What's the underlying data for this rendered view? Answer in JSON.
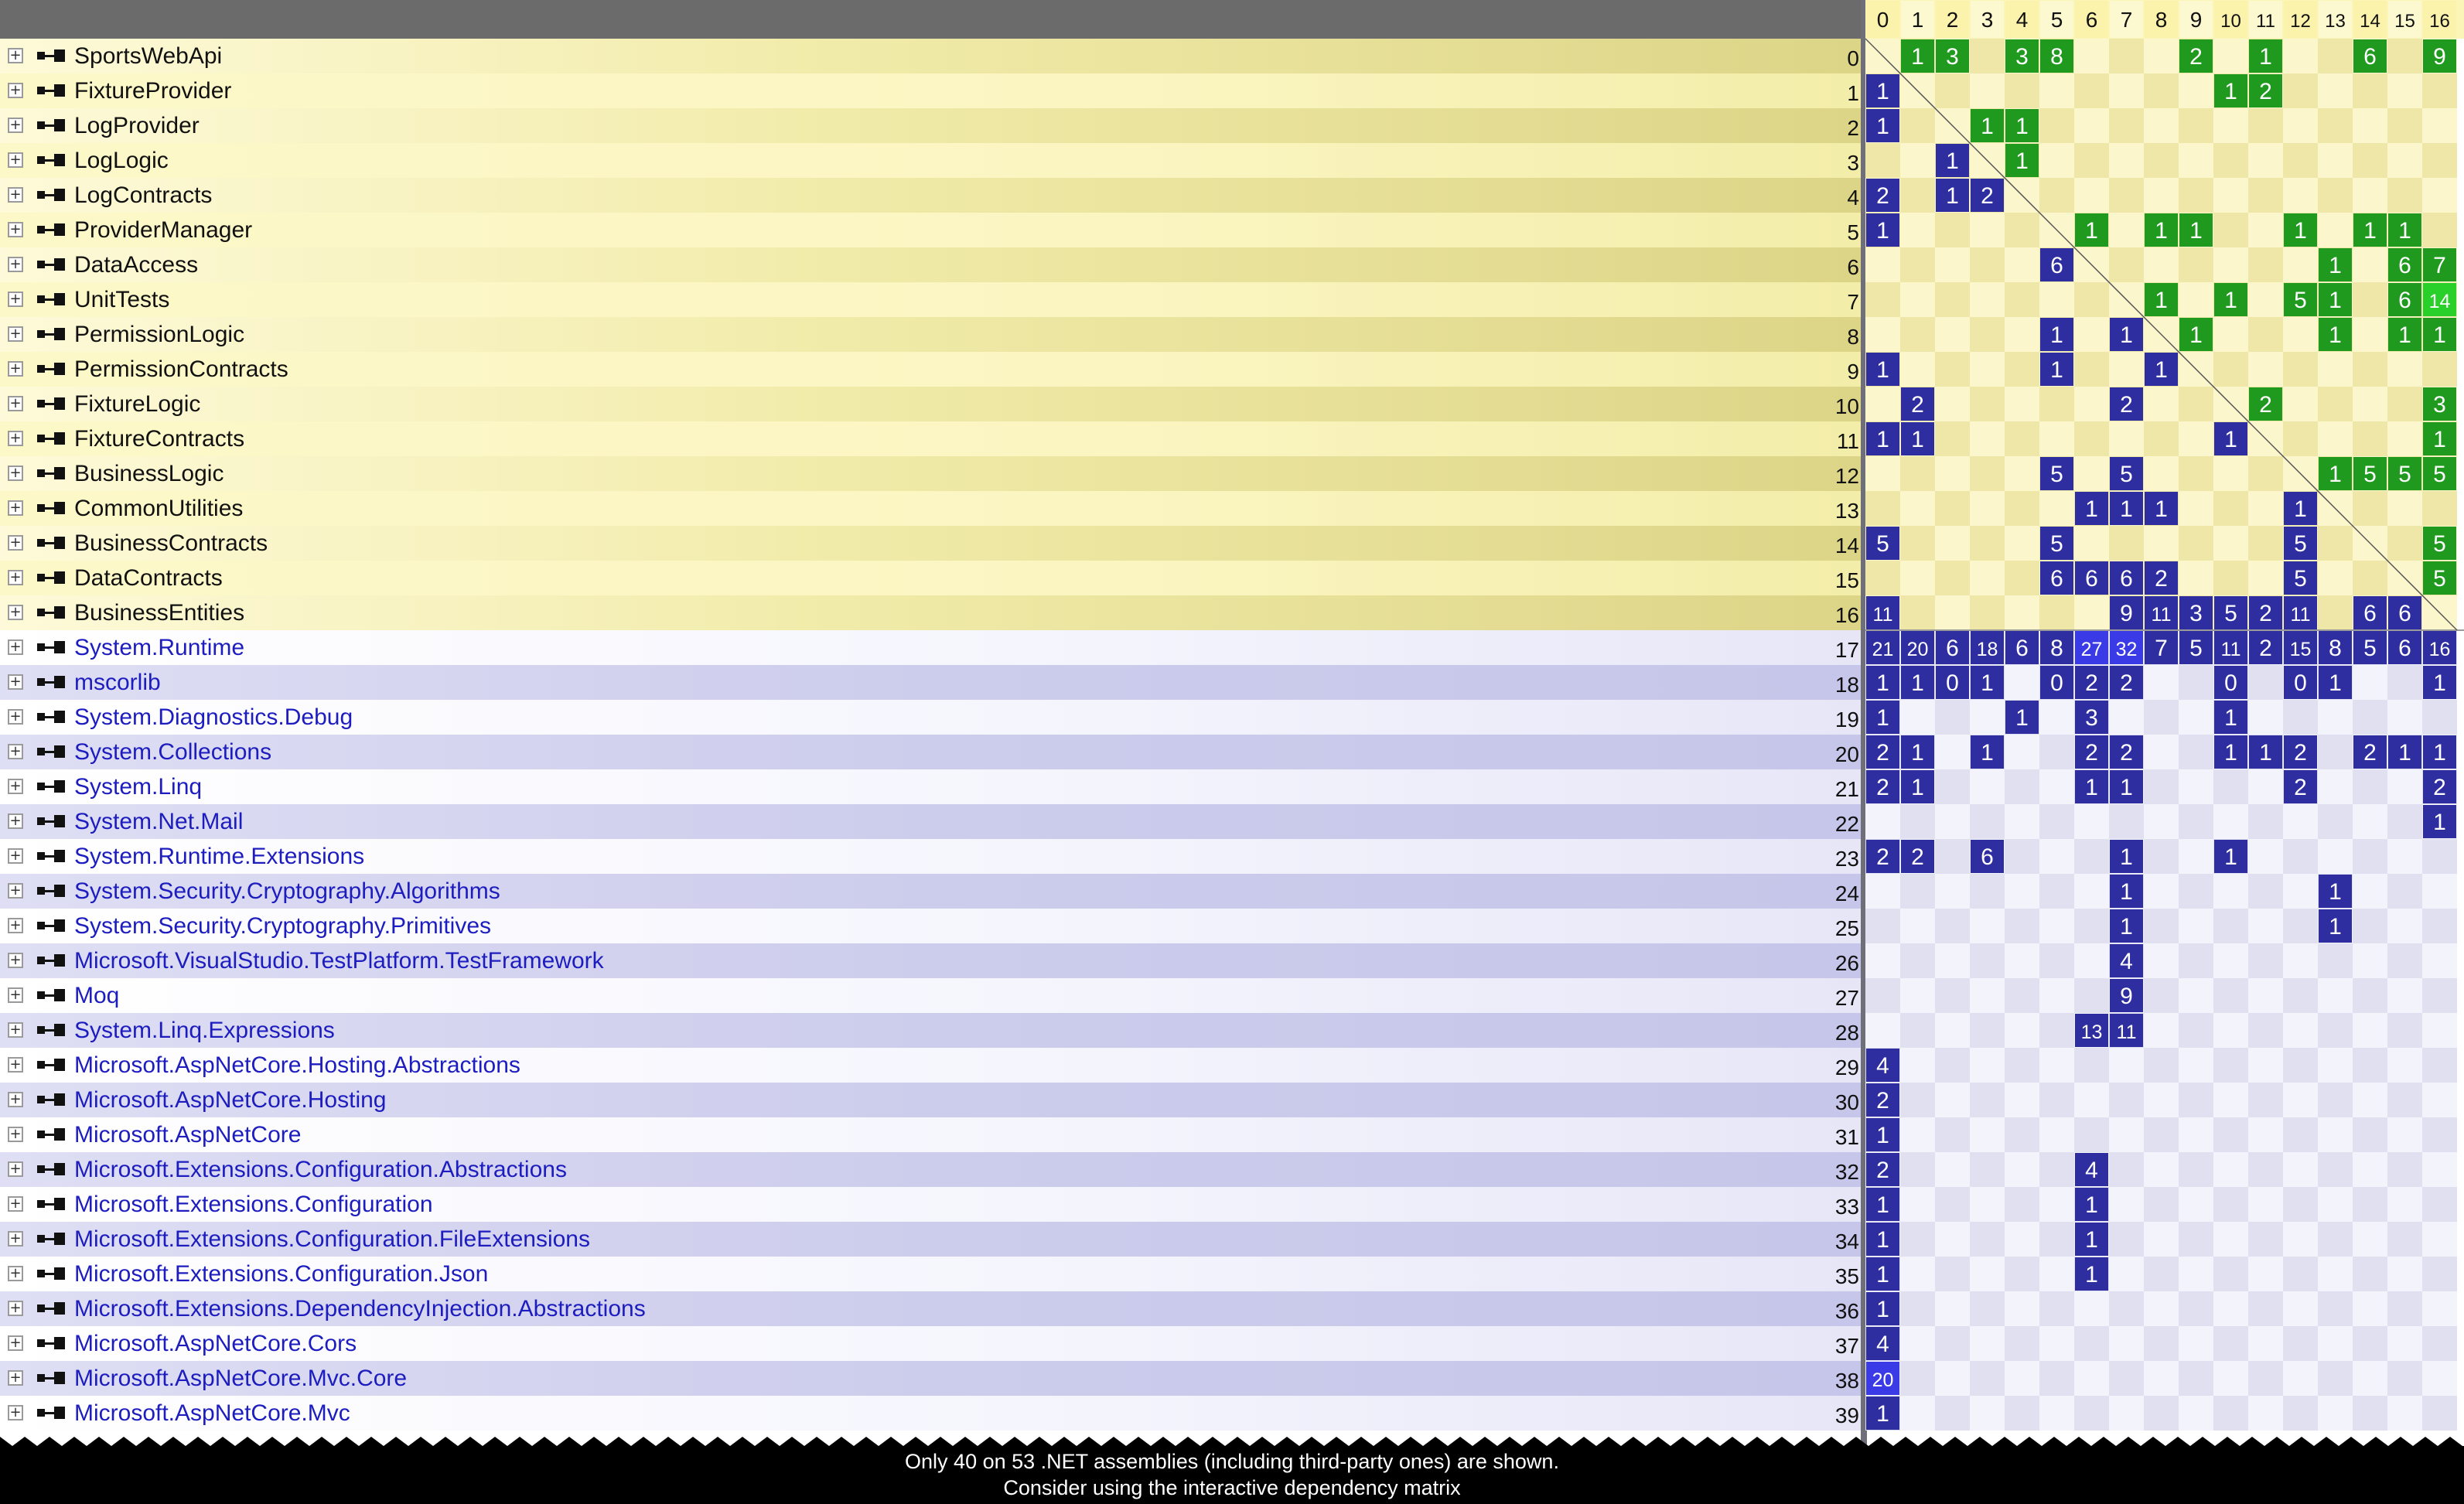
{
  "colors": {
    "app_row_even": "#dcd486",
    "app_row_odd": "#fdf8c8",
    "sys_row_even": "#c6c6ea",
    "sys_row_odd": "#f4f4fd",
    "app_text": "#111111",
    "sys_text": "#1d1dbf",
    "cell_used_by": "#2e2ea0",
    "cell_uses": "#1f9a1f",
    "cell_bright": "#3a3ae6",
    "cell_bright_green": "#2ad02a",
    "header_bg": "#fcf5b8",
    "matrix_app_a": "#fbf6cc",
    "matrix_app_b": "#efe7a8",
    "matrix_sys_a": "#f3f3fb",
    "matrix_sys_b": "#e0e0f1"
  },
  "row_icons": {
    "expander": "plus-icon",
    "assembly": "assembly-icon"
  },
  "columns": [
    "0",
    "1",
    "2",
    "3",
    "4",
    "5",
    "6",
    "7",
    "8",
    "9",
    "10",
    "11",
    "12",
    "13",
    "14",
    "15",
    "16"
  ],
  "rows": [
    {
      "name": "SportsWebApi",
      "index": "0",
      "kind": "app"
    },
    {
      "name": "FixtureProvider",
      "index": "1",
      "kind": "app"
    },
    {
      "name": "LogProvider",
      "index": "2",
      "kind": "app"
    },
    {
      "name": "LogLogic",
      "index": "3",
      "kind": "app"
    },
    {
      "name": "LogContracts",
      "index": "4",
      "kind": "app"
    },
    {
      "name": "ProviderManager",
      "index": "5",
      "kind": "app"
    },
    {
      "name": "DataAccess",
      "index": "6",
      "kind": "app"
    },
    {
      "name": "UnitTests",
      "index": "7",
      "kind": "app"
    },
    {
      "name": "PermissionLogic",
      "index": "8",
      "kind": "app"
    },
    {
      "name": "PermissionContracts",
      "index": "9",
      "kind": "app"
    },
    {
      "name": "FixtureLogic",
      "index": "10",
      "kind": "app"
    },
    {
      "name": "FixtureContracts",
      "index": "11",
      "kind": "app"
    },
    {
      "name": "BusinessLogic",
      "index": "12",
      "kind": "app"
    },
    {
      "name": "CommonUtilities",
      "index": "13",
      "kind": "app"
    },
    {
      "name": "BusinessContracts",
      "index": "14",
      "kind": "app"
    },
    {
      "name": "DataContracts",
      "index": "15",
      "kind": "app"
    },
    {
      "name": "BusinessEntities",
      "index": "16",
      "kind": "app"
    },
    {
      "name": "System.Runtime",
      "index": "17",
      "kind": "sys"
    },
    {
      "name": "mscorlib",
      "index": "18",
      "kind": "sys"
    },
    {
      "name": "System.Diagnostics.Debug",
      "index": "19",
      "kind": "sys"
    },
    {
      "name": "System.Collections",
      "index": "20",
      "kind": "sys"
    },
    {
      "name": "System.Linq",
      "index": "21",
      "kind": "sys"
    },
    {
      "name": "System.Net.Mail",
      "index": "22",
      "kind": "sys"
    },
    {
      "name": "System.Runtime.Extensions",
      "index": "23",
      "kind": "sys"
    },
    {
      "name": "System.Security.Cryptography.Algorithms",
      "index": "24",
      "kind": "sys"
    },
    {
      "name": "System.Security.Cryptography.Primitives",
      "index": "25",
      "kind": "sys"
    },
    {
      "name": "Microsoft.VisualStudio.TestPlatform.TestFramework",
      "index": "26",
      "kind": "sys"
    },
    {
      "name": "Moq",
      "index": "27",
      "kind": "sys"
    },
    {
      "name": "System.Linq.Expressions",
      "index": "28",
      "kind": "sys"
    },
    {
      "name": "Microsoft.AspNetCore.Hosting.Abstractions",
      "index": "29",
      "kind": "sys"
    },
    {
      "name": "Microsoft.AspNetCore.Hosting",
      "index": "30",
      "kind": "sys"
    },
    {
      "name": "Microsoft.AspNetCore",
      "index": "31",
      "kind": "sys"
    },
    {
      "name": "Microsoft.Extensions.Configuration.Abstractions",
      "index": "32",
      "kind": "sys"
    },
    {
      "name": "Microsoft.Extensions.Configuration",
      "index": "33",
      "kind": "sys"
    },
    {
      "name": "Microsoft.Extensions.Configuration.FileExtensions",
      "index": "34",
      "kind": "sys"
    },
    {
      "name": "Microsoft.Extensions.Configuration.Json",
      "index": "35",
      "kind": "sys"
    },
    {
      "name": "Microsoft.Extensions.DependencyInjection.Abstractions",
      "index": "36",
      "kind": "sys"
    },
    {
      "name": "Microsoft.AspNetCore.Cors",
      "index": "37",
      "kind": "sys"
    },
    {
      "name": "Microsoft.AspNetCore.Mvc.Core",
      "index": "38",
      "kind": "sys"
    },
    {
      "name": "Microsoft.AspNetCore.Mvc",
      "index": "39",
      "kind": "sys"
    }
  ],
  "cells": [
    [
      0,
      1,
      "1",
      "g"
    ],
    [
      0,
      2,
      "3",
      "g"
    ],
    [
      0,
      4,
      "3",
      "g"
    ],
    [
      0,
      5,
      "8",
      "g"
    ],
    [
      0,
      9,
      "2",
      "g"
    ],
    [
      0,
      11,
      "1",
      "g"
    ],
    [
      0,
      14,
      "6",
      "g"
    ],
    [
      0,
      16,
      "9",
      "g"
    ],
    [
      1,
      0,
      "1",
      "b"
    ],
    [
      1,
      10,
      "1",
      "g"
    ],
    [
      1,
      11,
      "2",
      "g"
    ],
    [
      2,
      0,
      "1",
      "b"
    ],
    [
      2,
      3,
      "1",
      "g"
    ],
    [
      2,
      4,
      "1",
      "g"
    ],
    [
      3,
      2,
      "1",
      "b"
    ],
    [
      3,
      4,
      "1",
      "g"
    ],
    [
      4,
      0,
      "2",
      "b"
    ],
    [
      4,
      2,
      "1",
      "b"
    ],
    [
      4,
      3,
      "2",
      "b"
    ],
    [
      5,
      0,
      "1",
      "b"
    ],
    [
      5,
      6,
      "1",
      "g"
    ],
    [
      5,
      8,
      "1",
      "g"
    ],
    [
      5,
      9,
      "1",
      "g"
    ],
    [
      5,
      12,
      "1",
      "g"
    ],
    [
      5,
      14,
      "1",
      "g"
    ],
    [
      5,
      15,
      "1",
      "g"
    ],
    [
      6,
      5,
      "6",
      "b"
    ],
    [
      6,
      13,
      "1",
      "g"
    ],
    [
      6,
      15,
      "6",
      "g"
    ],
    [
      6,
      16,
      "7",
      "g"
    ],
    [
      7,
      8,
      "1",
      "g"
    ],
    [
      7,
      10,
      "1",
      "g"
    ],
    [
      7,
      12,
      "5",
      "g"
    ],
    [
      7,
      13,
      "1",
      "g"
    ],
    [
      7,
      15,
      "6",
      "g"
    ],
    [
      7,
      16,
      "14",
      "G"
    ],
    [
      8,
      5,
      "1",
      "b"
    ],
    [
      8,
      7,
      "1",
      "b"
    ],
    [
      8,
      9,
      "1",
      "g"
    ],
    [
      8,
      13,
      "1",
      "g"
    ],
    [
      8,
      15,
      "1",
      "g"
    ],
    [
      8,
      16,
      "1",
      "g"
    ],
    [
      9,
      0,
      "1",
      "b"
    ],
    [
      9,
      5,
      "1",
      "b"
    ],
    [
      9,
      8,
      "1",
      "b"
    ],
    [
      10,
      1,
      "2",
      "b"
    ],
    [
      10,
      7,
      "2",
      "b"
    ],
    [
      10,
      11,
      "2",
      "g"
    ],
    [
      10,
      16,
      "3",
      "g"
    ],
    [
      11,
      0,
      "1",
      "b"
    ],
    [
      11,
      1,
      "1",
      "b"
    ],
    [
      11,
      10,
      "1",
      "b"
    ],
    [
      11,
      16,
      "1",
      "g"
    ],
    [
      12,
      5,
      "5",
      "b"
    ],
    [
      12,
      7,
      "5",
      "b"
    ],
    [
      12,
      13,
      "1",
      "g"
    ],
    [
      12,
      14,
      "5",
      "g"
    ],
    [
      12,
      15,
      "5",
      "g"
    ],
    [
      12,
      16,
      "5",
      "g"
    ],
    [
      13,
      6,
      "1",
      "b"
    ],
    [
      13,
      7,
      "1",
      "b"
    ],
    [
      13,
      8,
      "1",
      "b"
    ],
    [
      13,
      12,
      "1",
      "b"
    ],
    [
      14,
      0,
      "5",
      "b"
    ],
    [
      14,
      5,
      "5",
      "b"
    ],
    [
      14,
      12,
      "5",
      "b"
    ],
    [
      14,
      16,
      "5",
      "g"
    ],
    [
      15,
      5,
      "6",
      "b"
    ],
    [
      15,
      6,
      "6",
      "b"
    ],
    [
      15,
      7,
      "6",
      "b"
    ],
    [
      15,
      8,
      "2",
      "b"
    ],
    [
      15,
      12,
      "5",
      "b"
    ],
    [
      15,
      16,
      "5",
      "g"
    ],
    [
      16,
      0,
      "11",
      "b"
    ],
    [
      16,
      7,
      "9",
      "b"
    ],
    [
      16,
      8,
      "11",
      "b"
    ],
    [
      16,
      9,
      "3",
      "b"
    ],
    [
      16,
      10,
      "5",
      "b"
    ],
    [
      16,
      11,
      "2",
      "b"
    ],
    [
      16,
      12,
      "11",
      "b"
    ],
    [
      16,
      14,
      "6",
      "b"
    ],
    [
      16,
      15,
      "6",
      "b"
    ],
    [
      17,
      0,
      "21",
      "b"
    ],
    [
      17,
      1,
      "20",
      "b"
    ],
    [
      17,
      2,
      "6",
      "b"
    ],
    [
      17,
      3,
      "18",
      "b"
    ],
    [
      17,
      4,
      "6",
      "b"
    ],
    [
      17,
      5,
      "8",
      "b"
    ],
    [
      17,
      6,
      "27",
      "B"
    ],
    [
      17,
      7,
      "32",
      "B"
    ],
    [
      17,
      8,
      "7",
      "b"
    ],
    [
      17,
      9,
      "5",
      "b"
    ],
    [
      17,
      10,
      "11",
      "b"
    ],
    [
      17,
      11,
      "2",
      "b"
    ],
    [
      17,
      12,
      "15",
      "b"
    ],
    [
      17,
      13,
      "8",
      "b"
    ],
    [
      17,
      14,
      "5",
      "b"
    ],
    [
      17,
      15,
      "6",
      "b"
    ],
    [
      17,
      16,
      "16",
      "b"
    ],
    [
      18,
      0,
      "1",
      "b"
    ],
    [
      18,
      1,
      "1",
      "b"
    ],
    [
      18,
      2,
      "0",
      "b"
    ],
    [
      18,
      3,
      "1",
      "b"
    ],
    [
      18,
      5,
      "0",
      "b"
    ],
    [
      18,
      6,
      "2",
      "b"
    ],
    [
      18,
      7,
      "2",
      "b"
    ],
    [
      18,
      10,
      "0",
      "b"
    ],
    [
      18,
      12,
      "0",
      "b"
    ],
    [
      18,
      13,
      "1",
      "b"
    ],
    [
      18,
      16,
      "1",
      "b"
    ],
    [
      19,
      0,
      "1",
      "b"
    ],
    [
      19,
      4,
      "1",
      "b"
    ],
    [
      19,
      6,
      "3",
      "b"
    ],
    [
      19,
      10,
      "1",
      "b"
    ],
    [
      20,
      0,
      "2",
      "b"
    ],
    [
      20,
      1,
      "1",
      "b"
    ],
    [
      20,
      3,
      "1",
      "b"
    ],
    [
      20,
      6,
      "2",
      "b"
    ],
    [
      20,
      7,
      "2",
      "b"
    ],
    [
      20,
      10,
      "1",
      "b"
    ],
    [
      20,
      11,
      "1",
      "b"
    ],
    [
      20,
      12,
      "2",
      "b"
    ],
    [
      20,
      14,
      "2",
      "b"
    ],
    [
      20,
      15,
      "1",
      "b"
    ],
    [
      20,
      16,
      "1",
      "b"
    ],
    [
      21,
      0,
      "2",
      "b"
    ],
    [
      21,
      1,
      "1",
      "b"
    ],
    [
      21,
      6,
      "1",
      "b"
    ],
    [
      21,
      7,
      "1",
      "b"
    ],
    [
      21,
      12,
      "2",
      "b"
    ],
    [
      21,
      16,
      "2",
      "b"
    ],
    [
      22,
      16,
      "1",
      "b"
    ],
    [
      23,
      0,
      "2",
      "b"
    ],
    [
      23,
      1,
      "2",
      "b"
    ],
    [
      23,
      3,
      "6",
      "b"
    ],
    [
      23,
      7,
      "1",
      "b"
    ],
    [
      23,
      10,
      "1",
      "b"
    ],
    [
      24,
      7,
      "1",
      "b"
    ],
    [
      24,
      13,
      "1",
      "b"
    ],
    [
      25,
      7,
      "1",
      "b"
    ],
    [
      25,
      13,
      "1",
      "b"
    ],
    [
      26,
      7,
      "4",
      "b"
    ],
    [
      27,
      7,
      "9",
      "b"
    ],
    [
      28,
      6,
      "13",
      "b"
    ],
    [
      28,
      7,
      "11",
      "b"
    ],
    [
      29,
      0,
      "4",
      "b"
    ],
    [
      30,
      0,
      "2",
      "b"
    ],
    [
      31,
      0,
      "1",
      "b"
    ],
    [
      32,
      0,
      "2",
      "b"
    ],
    [
      32,
      6,
      "4",
      "b"
    ],
    [
      33,
      0,
      "1",
      "b"
    ],
    [
      33,
      6,
      "1",
      "b"
    ],
    [
      34,
      0,
      "1",
      "b"
    ],
    [
      34,
      6,
      "1",
      "b"
    ],
    [
      35,
      0,
      "1",
      "b"
    ],
    [
      35,
      6,
      "1",
      "b"
    ],
    [
      36,
      0,
      "1",
      "b"
    ],
    [
      37,
      0,
      "4",
      "b"
    ],
    [
      38,
      0,
      "20",
      "B"
    ],
    [
      39,
      0,
      "1",
      "b"
    ]
  ],
  "footer": {
    "line1": "Only 40 on 53 .NET assemblies (including third-party ones) are shown.",
    "line2": "Consider using the interactive dependency matrix"
  }
}
